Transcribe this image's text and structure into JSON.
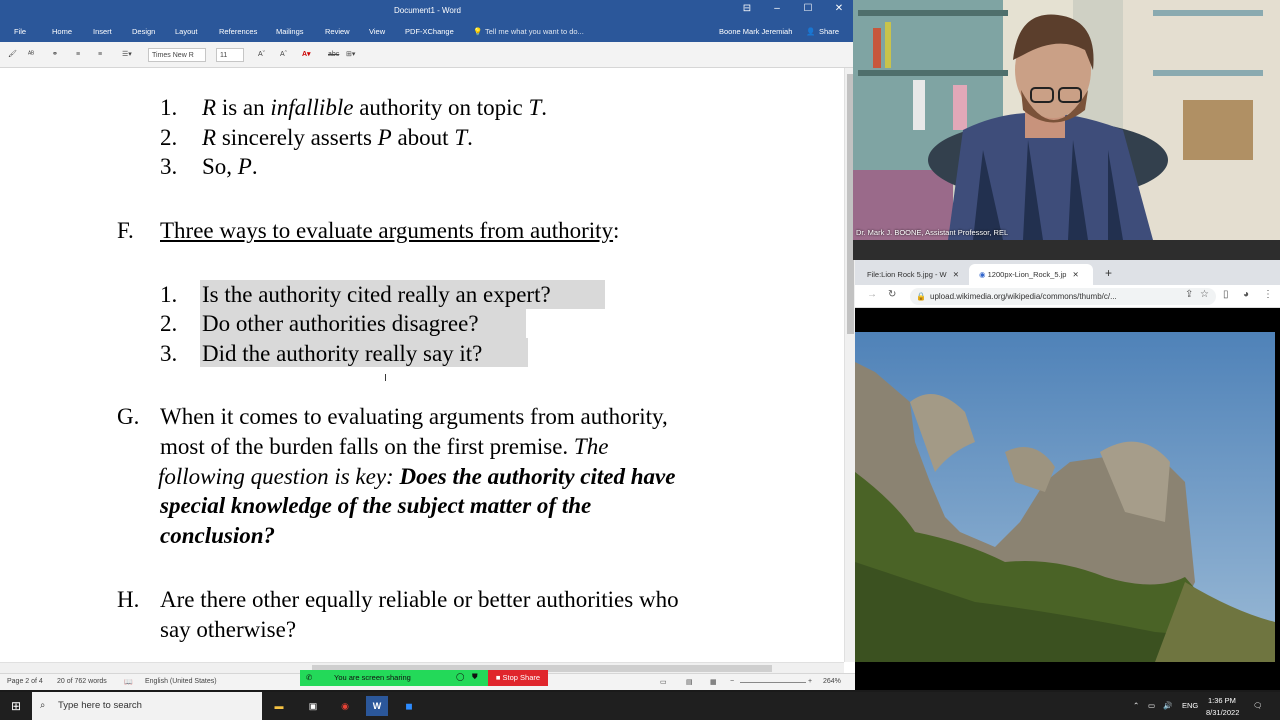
{
  "word": {
    "title": "Document1 - Word",
    "menu": [
      "File",
      "Home",
      "Insert",
      "Design",
      "Layout",
      "References",
      "Mailings",
      "Review",
      "View",
      "PDF-XChange"
    ],
    "tell_me": "Tell me what you want to do...",
    "user": "Boone Mark Jeremiah",
    "share": "Share",
    "font_name": "Times New R",
    "font_size": "11",
    "doc": {
      "list1": [
        {
          "n": "1.",
          "a": "R",
          "b": " is an ",
          "c": "infallible",
          "d": " authority on topic ",
          "e": "T",
          "f": "."
        },
        {
          "n": "2.",
          "a": "R",
          "b": " sincerely asserts ",
          "c": "P",
          "d": " about ",
          "e": "T",
          "f": "."
        },
        {
          "n": "3.",
          "a": "So, ",
          "b": "P",
          "c": "."
        }
      ],
      "F": {
        "letter": "F.",
        "text": "Three ways to evaluate arguments from authority",
        "colon": ":"
      },
      "list2": [
        {
          "n": "1.",
          "t": "Is the authority cited really an expert?"
        },
        {
          "n": "2.",
          "t": "Do other authorities disagree?"
        },
        {
          "n": "3.",
          "t": "Did the authority really say it?"
        }
      ],
      "G": {
        "letter": "G.",
        "l1": "When it comes to evaluating arguments from authority,",
        "l2a": "most of the burden falls on the first premise.  ",
        "l2b": "The",
        "l3a": "following question is key: ",
        "l3b": "Does the authority cited have",
        "l4": "special knowledge of the subject matter of the",
        "l5": "conclusion?"
      },
      "H": {
        "letter": "H.",
        "l1": "Are there other equally reliable or better authorities who",
        "l2": "say otherwise?"
      }
    },
    "status": {
      "page": "Page 2 of 4",
      "words": "20 of 762 words",
      "language": "English (United States)",
      "zoom": "264%"
    },
    "sharing": {
      "text": "You are screen sharing",
      "stop": "Stop Share"
    }
  },
  "cam": {
    "label": "Dr. Mark J. BOONE, Assistant Professor, REL"
  },
  "chrome": {
    "tab1": "File:Lion Rock 5.jpg - W",
    "tab2": "1200px-Lion_Rock_5.jp",
    "url": "upload.wikimedia.org/wikipedia/commons/thumb/c/..."
  },
  "taskbar": {
    "search": "Type here to search",
    "lang": "ENG",
    "time": "1:36 PM",
    "date": "8/31/2022"
  },
  "colors": {
    "word_blue": "#2b579a",
    "highlight": "#d9d9d9",
    "stop_red": "#e0262c",
    "share_green": "#23d959"
  }
}
